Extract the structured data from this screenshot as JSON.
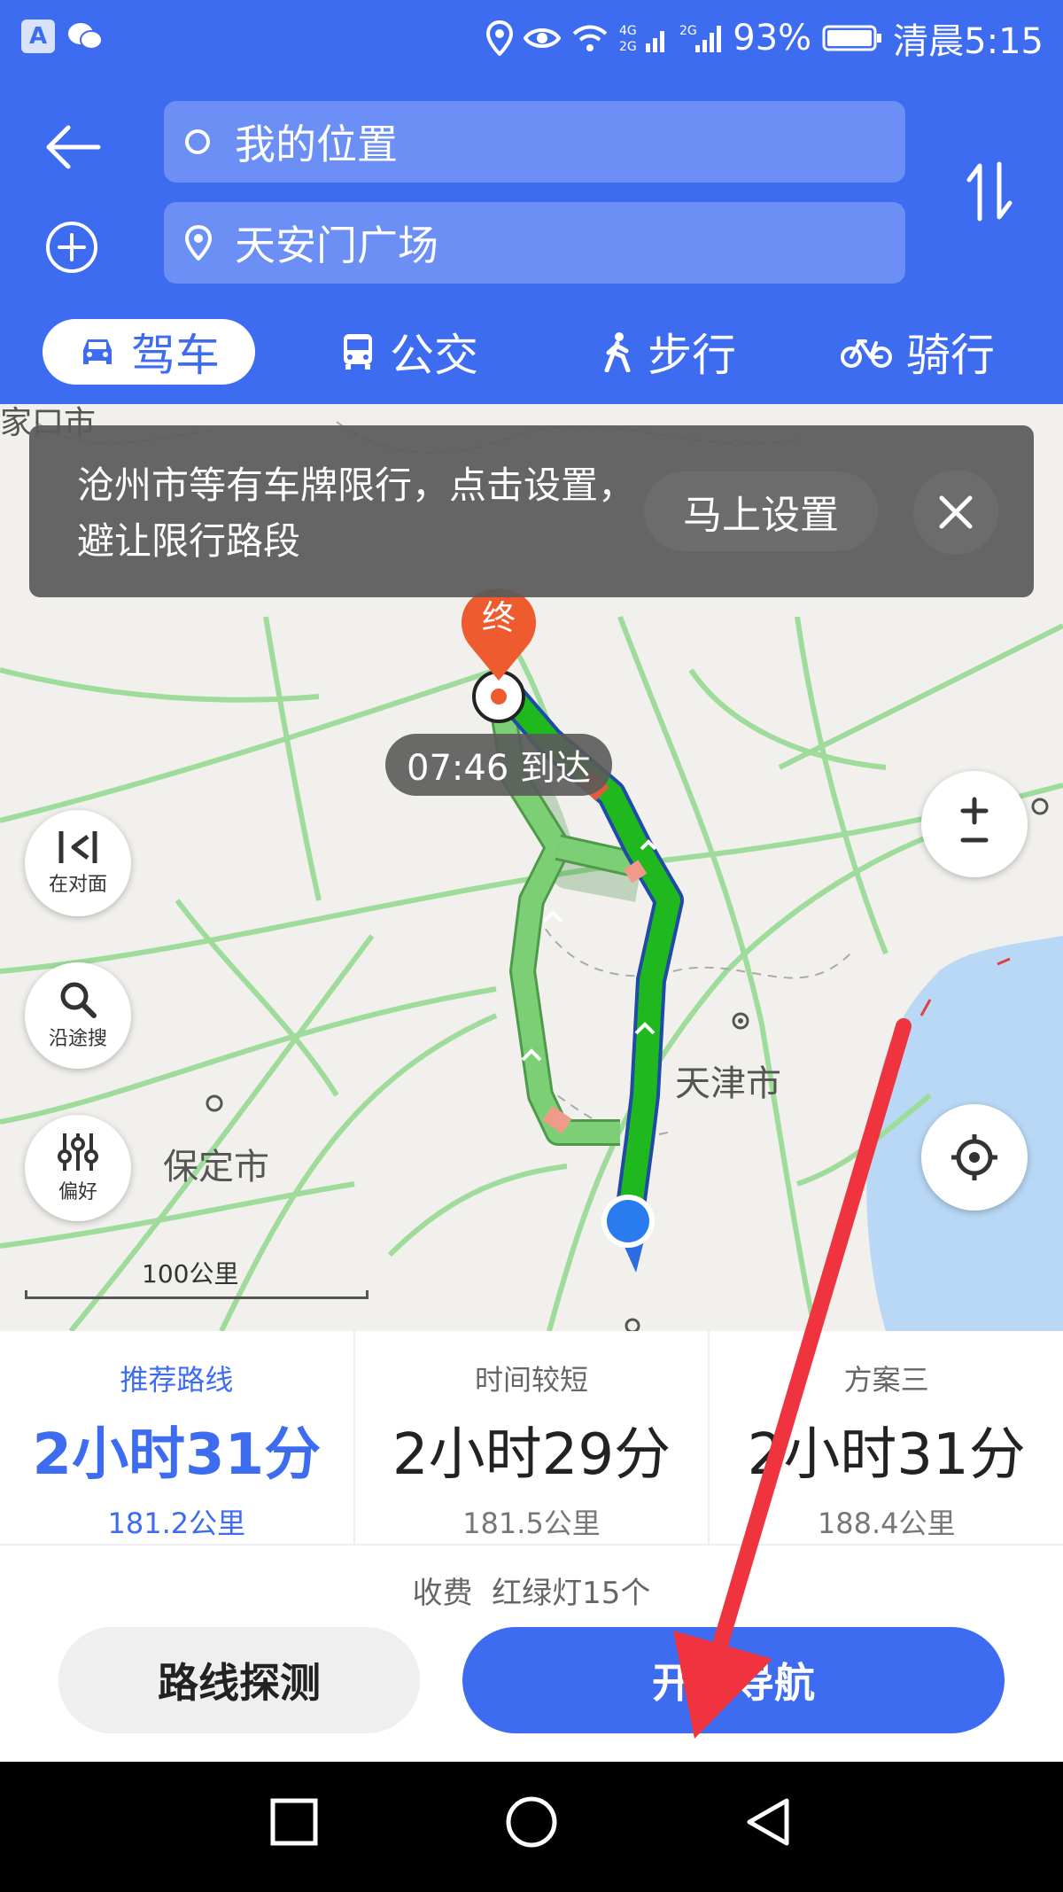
{
  "status_bar": {
    "battery": "93%",
    "time": "清晨5:15",
    "signal_label_1": "4G",
    "signal_label_2": "2G"
  },
  "header": {
    "origin": "我的位置",
    "destination": "天安门广场",
    "tabs": [
      {
        "label": "驾车",
        "icon": "car-icon",
        "active": true
      },
      {
        "label": "公交",
        "icon": "bus-icon",
        "active": false
      },
      {
        "label": "步行",
        "icon": "walk-icon",
        "active": false
      },
      {
        "label": "骑行",
        "icon": "bike-icon",
        "active": false
      }
    ]
  },
  "map": {
    "banner_text": "沧州市等有车牌限行，点击设置，避让限行路段",
    "banner_button": "马上设置",
    "end_marker": "终",
    "eta": "07:46 到达",
    "controls": {
      "opposite": "在对面",
      "search_along": "沿途搜",
      "preference": "偏好"
    },
    "labels": {
      "tianjin": "天津市",
      "baoding": "保定市",
      "zhangjiakou_partial": "家口市"
    },
    "scale": "100公里"
  },
  "routes": [
    {
      "label": "推荐路线",
      "time": "2小时31分",
      "distance": "181.2公里",
      "active": true
    },
    {
      "label": "时间较短",
      "time": "2小时29分",
      "distance": "181.5公里",
      "active": false
    },
    {
      "label": "方案三",
      "time": "2小时31分",
      "distance": "188.4公里",
      "active": false
    }
  ],
  "bottom": {
    "info": "收费  红绿灯15个",
    "detect_button": "路线探测",
    "navigate_button": "开始导航"
  },
  "colors": {
    "primary": "#3d6cf0",
    "route_main": "#1fb81f",
    "route_alt": "#7ccf74",
    "annotation_arrow": "#f0343f"
  }
}
